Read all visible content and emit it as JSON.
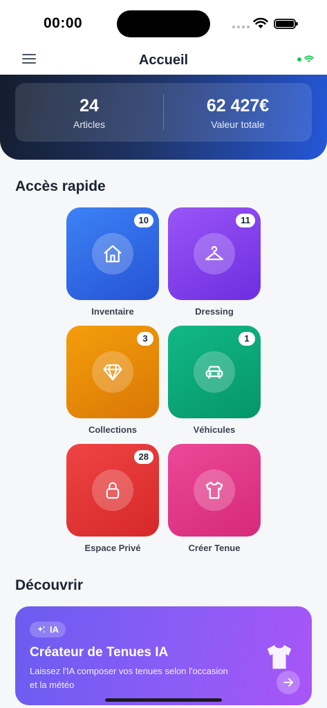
{
  "status_bar": {
    "time": "00:00",
    "icons": [
      "signal-dots-icon",
      "wifi-icon",
      "battery-icon"
    ]
  },
  "nav": {
    "title": "Accueil",
    "menu_icon": "menu-icon",
    "connection_icon": "wifi-icon",
    "connection_color": "#22c55e"
  },
  "stats": [
    {
      "value": "24",
      "label": "Articles"
    },
    {
      "value": "62 427€",
      "label": "Valeur totale"
    }
  ],
  "quick_access": {
    "title": "Accès rapide",
    "tiles": [
      {
        "label": "Inventaire",
        "badge": "10",
        "icon": "house-icon",
        "color": "#2f6bea"
      },
      {
        "label": "Dressing",
        "badge": "11",
        "icon": "hanger-icon",
        "color": "#8b44f0"
      },
      {
        "label": "Collections",
        "badge": "3",
        "icon": "diamond-icon",
        "color": "#f59e0b"
      },
      {
        "label": "Véhicules",
        "badge": "1",
        "icon": "car-icon",
        "color": "#10b981"
      },
      {
        "label": "Espace Privé",
        "badge": "28",
        "icon": "lock-icon",
        "color": "#ef4444"
      },
      {
        "label": "Créer Tenue",
        "badge": "",
        "icon": "tshirt-icon",
        "color": "#ec4899"
      }
    ]
  },
  "discover": {
    "title": "Découvrir",
    "card": {
      "badge": "IA",
      "badge_icon": "sparkles-icon",
      "title": "Créateur de Tenues IA",
      "description": "Laissez l'IA composer vos tenues selon l'occasion et la météo",
      "icon": "tshirt-icon",
      "action_icon": "arrow-right-icon"
    }
  }
}
